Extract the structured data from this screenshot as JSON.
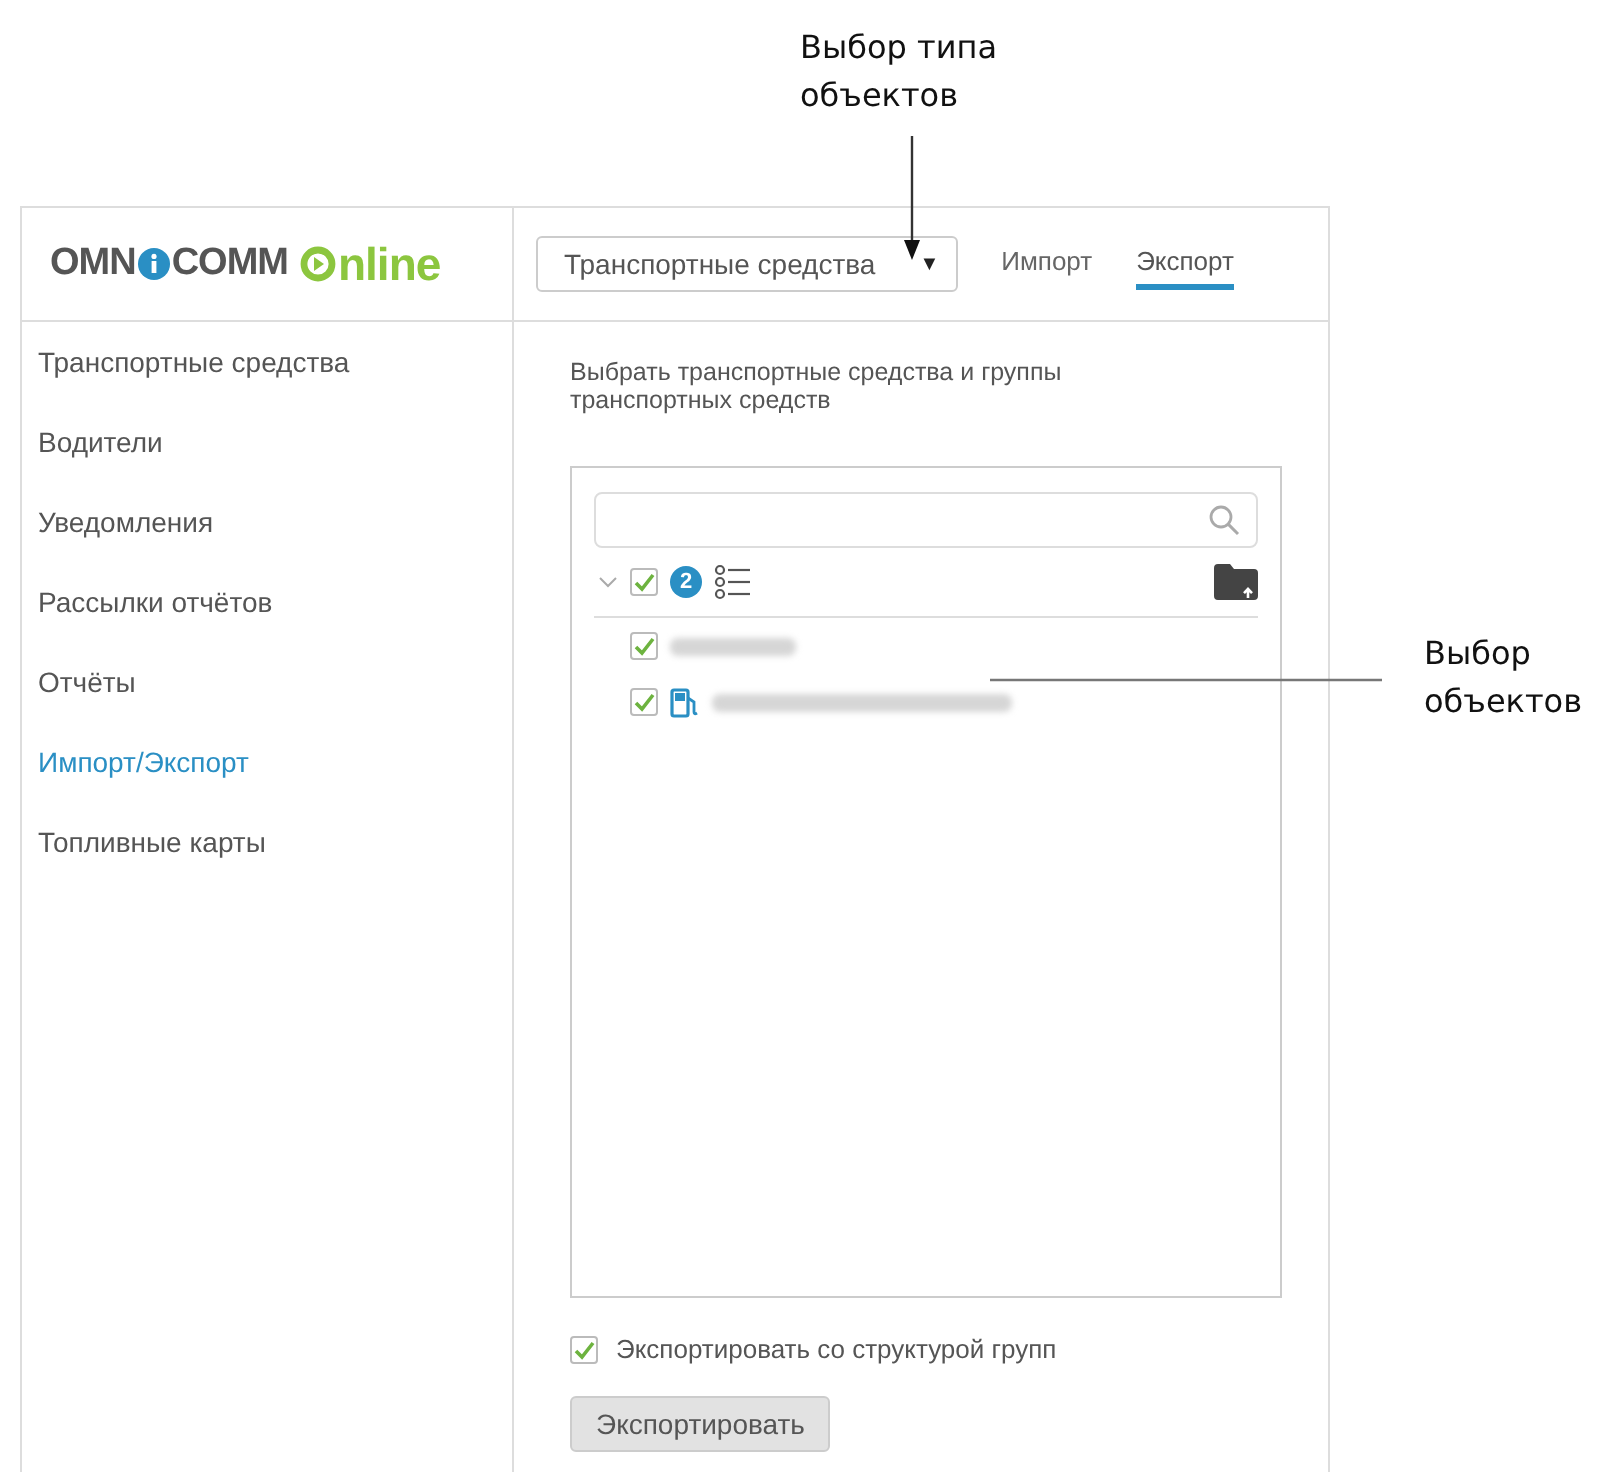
{
  "callouts": [
    {
      "text": "Выбор типа объектов",
      "kind": "down"
    },
    {
      "text": "Выбор объектов",
      "kind": "left"
    }
  ],
  "header": {
    "logo": {
      "part1": "OMN",
      "part2": "COMM",
      "part3": "nline"
    },
    "type_select": {
      "value": "Транспортные средства",
      "arrow": "▼"
    },
    "tabs": [
      {
        "label": "Импорт",
        "selected": false
      },
      {
        "label": "Экспорт",
        "selected": true
      }
    ]
  },
  "sidebar": {
    "items": [
      {
        "label": "Транспортные средства",
        "selected": false
      },
      {
        "label": "Водители",
        "selected": false
      },
      {
        "label": "Уведомления",
        "selected": false
      },
      {
        "label": "Рассылки отчётов",
        "selected": false
      },
      {
        "label": "Отчёты",
        "selected": false
      },
      {
        "label": "Импорт/Экспорт",
        "selected": true
      },
      {
        "label": "Топливные карты",
        "selected": false
      }
    ]
  },
  "main": {
    "heading": "Выбрать транспортные средства и группы транспортных средств",
    "tree": {
      "root": {
        "expanded": true,
        "checked": true,
        "count": "2"
      },
      "items": [
        {
          "kind": "plain",
          "checked": true
        },
        {
          "kind": "fuel",
          "checked": true
        }
      ]
    },
    "export_structure": {
      "label": "Экспортировать со структурой групп",
      "checked": true
    },
    "button": "Экспортировать"
  }
}
